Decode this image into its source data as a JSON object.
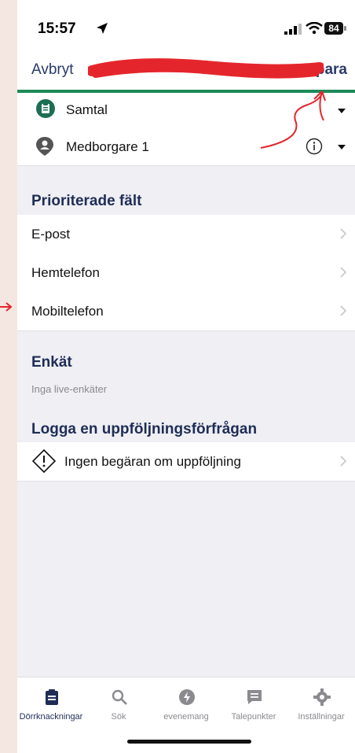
{
  "status_bar": {
    "time": "15:57",
    "battery": "84"
  },
  "nav": {
    "cancel": "Avbryt",
    "save": "Spara"
  },
  "contact_rows": [
    {
      "label": "Samtal",
      "icon": "clipboard-icon"
    },
    {
      "label": "Medborgare 1",
      "icon": "person-pin-icon"
    }
  ],
  "priority": {
    "title": "Prioriterade fält",
    "items": [
      "E-post",
      "Hemtelefon",
      "Mobiltelefon"
    ]
  },
  "survey": {
    "title": "Enkät",
    "empty": "Inga live-enkäter"
  },
  "followup": {
    "title": "Logga en uppföljningsförfrågan",
    "item": "Ingen begäran om uppföljning"
  },
  "tabs": [
    {
      "label": "Dörrknackningar",
      "icon": "clipboard-icon",
      "active": true
    },
    {
      "label": "Sök",
      "icon": "search-icon",
      "active": false
    },
    {
      "label": "evenemang",
      "icon": "bolt-icon",
      "active": false
    },
    {
      "label": "Talepunkter",
      "icon": "message-icon",
      "active": false
    },
    {
      "label": "Inställningar",
      "icon": "gear-icon",
      "active": false
    }
  ],
  "colors": {
    "accent": "#1d8a5a",
    "brand_text": "#1f2d56",
    "annotation": "#e4262c"
  }
}
